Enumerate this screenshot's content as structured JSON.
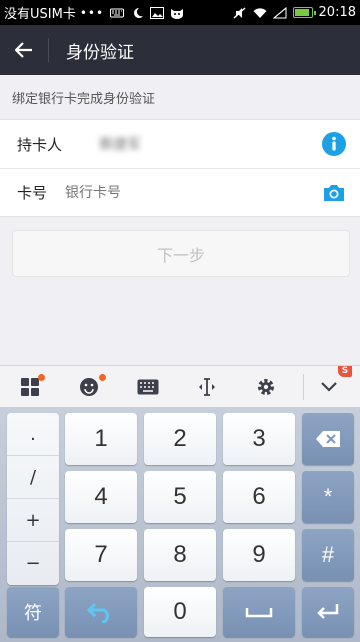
{
  "status_bar": {
    "carrier": "没有USIM卡",
    "dots": "•••",
    "time": "20:18",
    "battery_level": 0.95,
    "icons": [
      "keyboard-icon",
      "moon-icon",
      "image-icon",
      "cat-icon",
      "mute-icon",
      "wifi-icon",
      "signal-icon",
      "battery-icon"
    ]
  },
  "nav": {
    "back_icon": "arrow-left-icon",
    "title": "身份验证"
  },
  "form": {
    "hint": "绑定银行卡完成身份验证",
    "holder_label": "持卡人",
    "holder_value": "蔡建军",
    "info_icon": "info-icon",
    "card_label": "卡号",
    "card_placeholder": "银行卡号",
    "camera_icon": "camera-icon",
    "next_label": "下一步"
  },
  "keyboard": {
    "toolbar_icons": [
      "grid-icon",
      "emoji-icon",
      "keyboard-icon",
      "cursor-icon",
      "settings-icon",
      "collapse-icon"
    ],
    "badge_letter": "S",
    "symbols": [
      ".",
      "/",
      "+",
      "−"
    ],
    "digits": [
      "1",
      "2",
      "3",
      "4",
      "5",
      "6",
      "7",
      "8",
      "9",
      "0"
    ],
    "asterisk": "*",
    "hash": "#",
    "symbol_key": "符",
    "colors": {
      "accent": "#1ea0e6",
      "nav_bg": "#2c2f3a",
      "fn_key": "#7f97b9"
    }
  }
}
